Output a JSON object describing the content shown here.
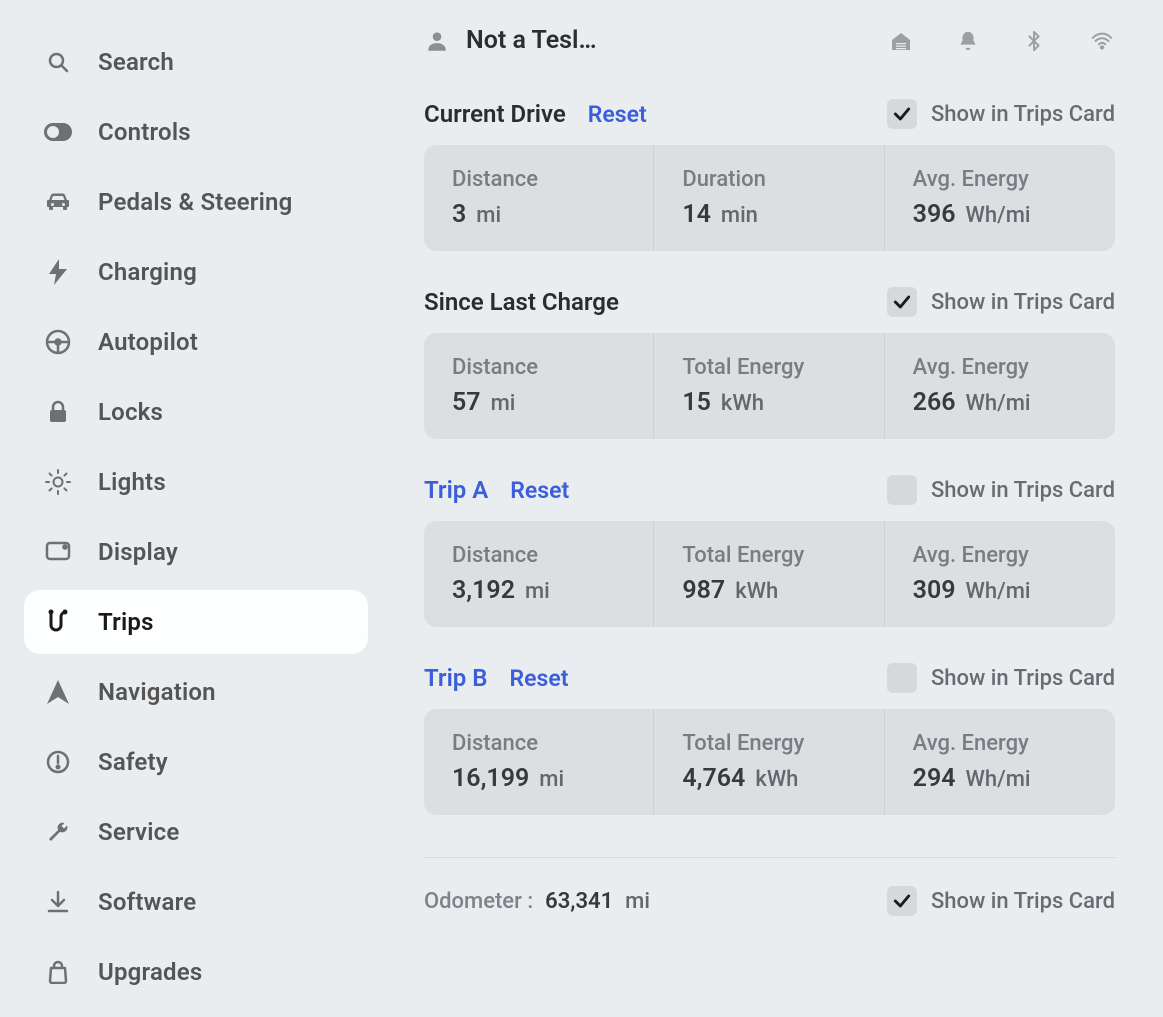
{
  "sidebar": {
    "items": [
      {
        "icon": "search",
        "label": "Search"
      },
      {
        "icon": "toggle",
        "label": "Controls"
      },
      {
        "icon": "car",
        "label": "Pedals & Steering"
      },
      {
        "icon": "bolt",
        "label": "Charging"
      },
      {
        "icon": "wheel",
        "label": "Autopilot"
      },
      {
        "icon": "lock",
        "label": "Locks"
      },
      {
        "icon": "bulb",
        "label": "Lights"
      },
      {
        "icon": "display",
        "label": "Display"
      },
      {
        "icon": "trips",
        "label": "Trips"
      },
      {
        "icon": "nav",
        "label": "Navigation"
      },
      {
        "icon": "safety",
        "label": "Safety"
      },
      {
        "icon": "wrench",
        "label": "Service"
      },
      {
        "icon": "download",
        "label": "Software"
      },
      {
        "icon": "bag",
        "label": "Upgrades"
      }
    ],
    "activeIndex": 8
  },
  "topbar": {
    "userName": "Not a Tesl…",
    "statusIcons": [
      "home",
      "bell",
      "bluetooth",
      "wifi"
    ]
  },
  "showLabel": "Show in Trips Card",
  "resetLabel": "Reset",
  "sections": [
    {
      "id": "current-drive",
      "title": "Current Drive",
      "titleIsLink": false,
      "hasReset": true,
      "checked": true,
      "cells": [
        {
          "label": "Distance",
          "value": "3",
          "unit": "mi"
        },
        {
          "label": "Duration",
          "value": "14",
          "unit": "min"
        },
        {
          "label": "Avg. Energy",
          "value": "396",
          "unit": "Wh/mi"
        }
      ]
    },
    {
      "id": "since-last-charge",
      "title": "Since Last Charge",
      "titleIsLink": false,
      "hasReset": false,
      "checked": true,
      "cells": [
        {
          "label": "Distance",
          "value": "57",
          "unit": "mi"
        },
        {
          "label": "Total Energy",
          "value": "15",
          "unit": "kWh"
        },
        {
          "label": "Avg. Energy",
          "value": "266",
          "unit": "Wh/mi"
        }
      ]
    },
    {
      "id": "trip-a",
      "title": "Trip A",
      "titleIsLink": true,
      "hasReset": true,
      "checked": false,
      "cells": [
        {
          "label": "Distance",
          "value": "3,192",
          "unit": "mi"
        },
        {
          "label": "Total Energy",
          "value": "987",
          "unit": "kWh"
        },
        {
          "label": "Avg. Energy",
          "value": "309",
          "unit": "Wh/mi"
        }
      ]
    },
    {
      "id": "trip-b",
      "title": "Trip B",
      "titleIsLink": true,
      "hasReset": true,
      "checked": false,
      "cells": [
        {
          "label": "Distance",
          "value": "16,199",
          "unit": "mi"
        },
        {
          "label": "Total Energy",
          "value": "4,764",
          "unit": "kWh"
        },
        {
          "label": "Avg. Energy",
          "value": "294",
          "unit": "Wh/mi"
        }
      ]
    }
  ],
  "odometer": {
    "label": "Odometer  :",
    "value": "63,341",
    "unit": "mi",
    "checked": true
  }
}
